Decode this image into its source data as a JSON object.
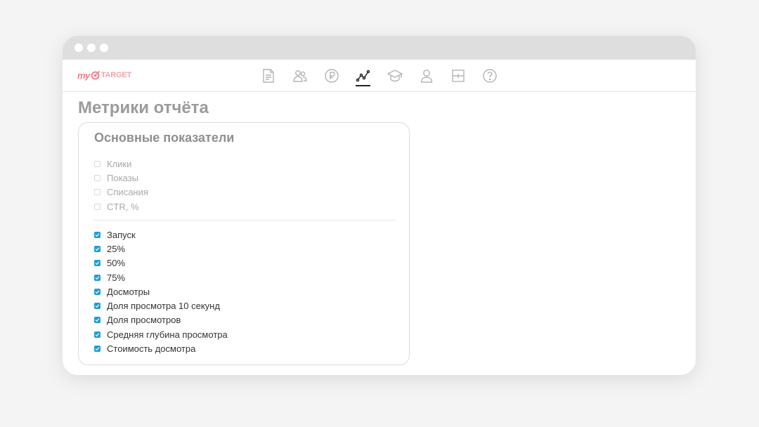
{
  "logo": {
    "my": "my",
    "target": "TARGET"
  },
  "nav": {
    "icons": [
      {
        "name": "campaigns-icon"
      },
      {
        "name": "audiences-icon"
      },
      {
        "name": "billing-icon"
      },
      {
        "name": "statistics-icon",
        "active": true
      },
      {
        "name": "education-icon"
      },
      {
        "name": "profile-icon"
      },
      {
        "name": "layout-icon"
      },
      {
        "name": "help-icon"
      }
    ]
  },
  "page": {
    "title": "Метрики отчёта"
  },
  "card": {
    "title": "Основные показатели",
    "basic": [
      {
        "label": "Клики",
        "checked": false
      },
      {
        "label": "Показы",
        "checked": false
      },
      {
        "label": "Списания",
        "checked": false
      },
      {
        "label": "CTR, %",
        "checked": false
      }
    ],
    "video": [
      {
        "label": "Запуск",
        "checked": true
      },
      {
        "label": "25%",
        "checked": true
      },
      {
        "label": "50%",
        "checked": true
      },
      {
        "label": "75%",
        "checked": true
      },
      {
        "label": "Досмотры",
        "checked": true
      },
      {
        "label": "Доля просмотра 10 секунд",
        "checked": true
      },
      {
        "label": "Доля просмотров",
        "checked": true
      },
      {
        "label": "Средняя глубина просмотра",
        "checked": true
      },
      {
        "label": "Стоимость досмотра",
        "checked": true
      }
    ]
  },
  "colors": {
    "accent": "#1a9fde",
    "brand": "#f27a86"
  }
}
